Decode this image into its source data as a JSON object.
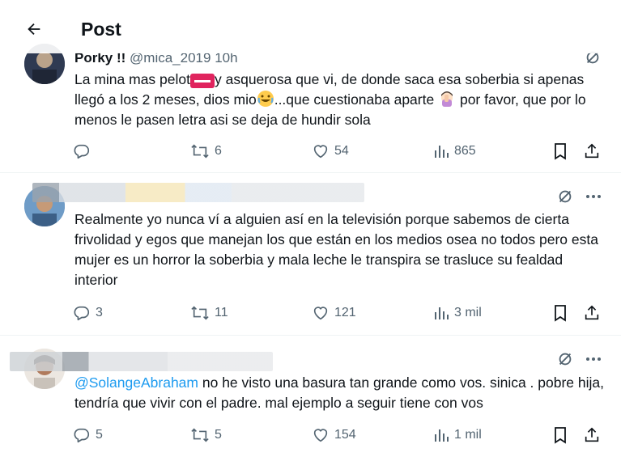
{
  "header": {
    "title": "Post"
  },
  "posts": [
    {
      "name": "Porky !!",
      "handle": "@mica_2019",
      "time": "10h",
      "text_before": "La mina mas pelot",
      "text_after": "y asquerosa que vi, de donde saca esa soberbia si apenas llegó a los 2 meses, dios mio",
      "text_after_emoji1": "...que cuestionaba aparte",
      "text_after_emoji2": " por favor, que por lo menos le pasen letra asi se deja de hundir sola",
      "stats": {
        "replies": "",
        "reposts": "6",
        "likes": "54",
        "views": "865"
      }
    },
    {
      "text": "Realmente yo nunca ví a alguien así en la televisión porque sabemos de cierta frivolidad y egos que manejan los que están en los medios osea no todos pero esta mujer es un horror la soberbia y mala leche le transpira se trasluce su fealdad interior",
      "stats": {
        "replies": "3",
        "reposts": "11",
        "likes": "121",
        "views": "3 mil"
      }
    },
    {
      "mention": "@SolangeAbraham",
      "text": " no he visto una basura tan grande como vos. sinica . pobre hija, tendría que vivir con el padre. mal ejemplo a seguir tiene con vos",
      "stats": {
        "replies": "5",
        "reposts": "5",
        "likes": "154",
        "views": "1 mil"
      }
    }
  ],
  "icons": {
    "back": "arrow-left-icon",
    "grok": "grok-icon",
    "more": "more-icon",
    "reply": "reply-icon",
    "repost": "repost-icon",
    "like": "heart-icon",
    "views": "views-icon",
    "bookmark": "bookmark-icon",
    "share": "share-icon"
  },
  "colors": {
    "text": "#0f1419",
    "muted": "#536471",
    "link": "#1d9bf0",
    "divider": "#eff3f4",
    "redaction": "#e0245e"
  }
}
